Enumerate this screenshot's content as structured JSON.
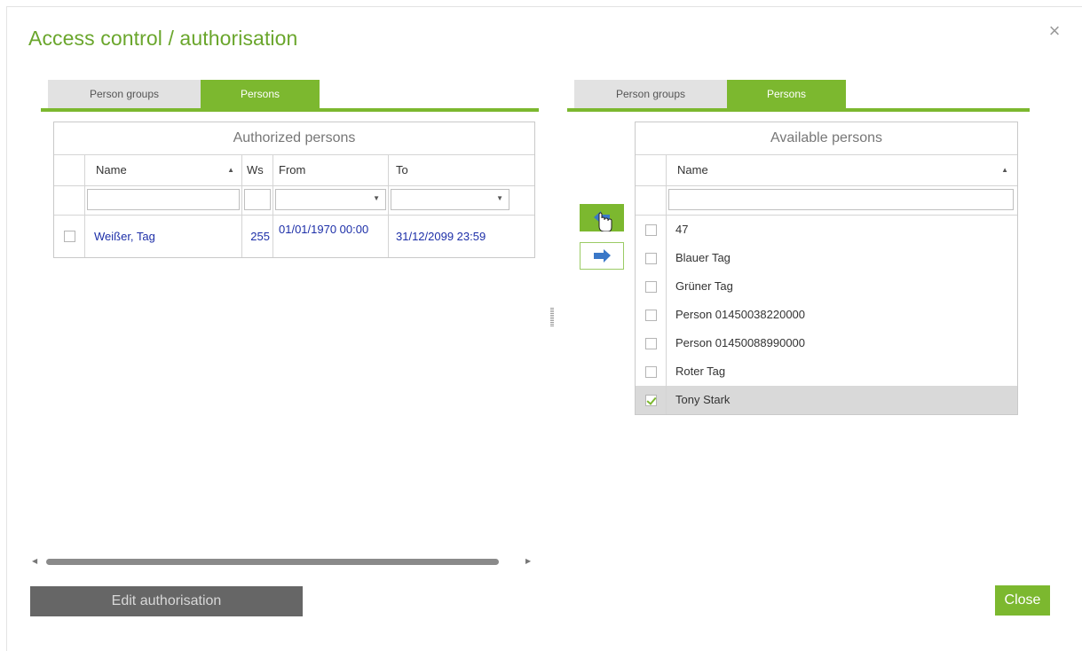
{
  "dialog": {
    "title": "Access control / authorisation",
    "close_icon": "×"
  },
  "left_tabs": [
    {
      "label": "Person groups",
      "active": false
    },
    {
      "label": "Persons",
      "active": true
    }
  ],
  "right_tabs": [
    {
      "label": "Person groups",
      "active": false
    },
    {
      "label": "Persons",
      "active": true
    }
  ],
  "authorized": {
    "caption": "Authorized persons",
    "columns": {
      "name": "Name",
      "ws": "Ws",
      "from": "From",
      "to": "To"
    },
    "sort_icon": "▲",
    "dropdown_icon": "▼",
    "rows": [
      {
        "checked": false,
        "name": "Weißer, Tag",
        "ws": "255",
        "from": "01/01/1970 00:00",
        "to": "31/12/2099 23:59"
      }
    ]
  },
  "available": {
    "caption": "Available persons",
    "columns": {
      "name": "Name"
    },
    "sort_icon": "▲",
    "rows": [
      {
        "checked": false,
        "name": "47"
      },
      {
        "checked": false,
        "name": "Blauer Tag"
      },
      {
        "checked": false,
        "name": "Grüner Tag"
      },
      {
        "checked": false,
        "name": "Person 01450038220000"
      },
      {
        "checked": false,
        "name": "Person 01450088990000"
      },
      {
        "checked": false,
        "name": "Roter Tag"
      },
      {
        "checked": true,
        "name": "Tony Stark",
        "selected": true
      }
    ]
  },
  "transfer": {
    "add_icon": "arrow-left-icon",
    "remove_icon": "arrow-right-icon"
  },
  "scrollbar": {
    "left_arrow": "◀",
    "right_arrow": "▶"
  },
  "buttons": {
    "edit_label": "Edit authorisation",
    "close_label": "Close"
  },
  "colors": {
    "accent": "#7cb82f",
    "link": "#1d2fa8",
    "title": "#6aa62c"
  }
}
